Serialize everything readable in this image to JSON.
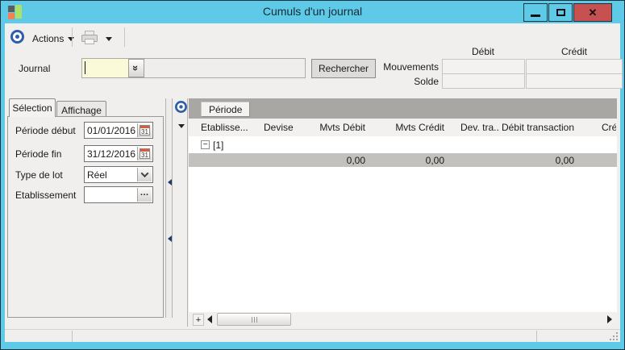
{
  "window": {
    "title": "Cumuls d'un journal",
    "close_glyph": "✕"
  },
  "toolbar": {
    "actions_label": "Actions"
  },
  "journal": {
    "label": "Journal",
    "value": "",
    "search_button": "Rechercher"
  },
  "totals": {
    "debit_header": "Débit",
    "credit_header": "Crédit",
    "mouvements_label": "Mouvements",
    "solde_label": "Solde",
    "mouvements_debit": "",
    "mouvements_credit": "",
    "solde_debit": "",
    "solde_credit": ""
  },
  "left_panel": {
    "tabs": [
      {
        "label": "Sélection",
        "active": true
      },
      {
        "label": "Affichage",
        "active": false
      }
    ],
    "fields": [
      {
        "label": "Période début",
        "value": "01/01/2016",
        "type": "date"
      },
      {
        "label": "Période fin",
        "value": "31/12/2016",
        "type": "date"
      },
      {
        "label": "Type de lot",
        "value": "Réel",
        "type": "select"
      },
      {
        "label": "Etablissement",
        "value": "",
        "type": "lookup"
      }
    ]
  },
  "grid": {
    "group_button": "Période",
    "columns": [
      {
        "label": "Etablisse..."
      },
      {
        "label": "Devise"
      },
      {
        "label": "Mvts Débit"
      },
      {
        "label": "Mvts Crédit"
      },
      {
        "label": "Dev. tra..."
      },
      {
        "label": "Débit transaction"
      },
      {
        "label": "Cré"
      }
    ],
    "group_toggle": "−",
    "group_row_label": "[1]",
    "summary_row": {
      "mvts_debit": "0,00",
      "mvts_credit": "0,00",
      "debit_transaction": "0,00"
    },
    "plus_button": "+"
  },
  "icons": {
    "double_chevron_down": "»",
    "calendar_day": "31",
    "ellipsis": "…"
  }
}
